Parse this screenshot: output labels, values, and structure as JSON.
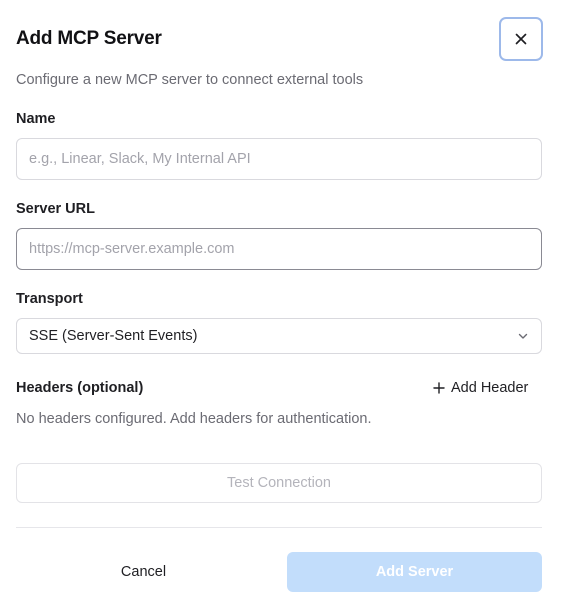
{
  "dialog": {
    "title": "Add MCP Server",
    "subtitle": "Configure a new MCP server to connect external tools",
    "close_icon": "close-icon"
  },
  "form": {
    "name": {
      "label": "Name",
      "value": "",
      "placeholder": "e.g., Linear, Slack, My Internal API"
    },
    "server_url": {
      "label": "Server URL",
      "value": "",
      "placeholder": "https://mcp-server.example.com"
    },
    "transport": {
      "label": "Transport",
      "selected": "SSE (Server-Sent Events)",
      "icon": "chevron-down-icon"
    },
    "headers": {
      "label": "Headers (optional)",
      "add_label": "Add Header",
      "add_icon": "plus-icon",
      "empty_text": "No headers configured. Add headers for authentication."
    }
  },
  "actions": {
    "test_label": "Test Connection",
    "cancel_label": "Cancel",
    "submit_label": "Add Server"
  },
  "colors": {
    "submit_bg": "#c2ddfb",
    "focus_ring": "#9db9ea",
    "disabled_text": "#b4b4bb"
  }
}
